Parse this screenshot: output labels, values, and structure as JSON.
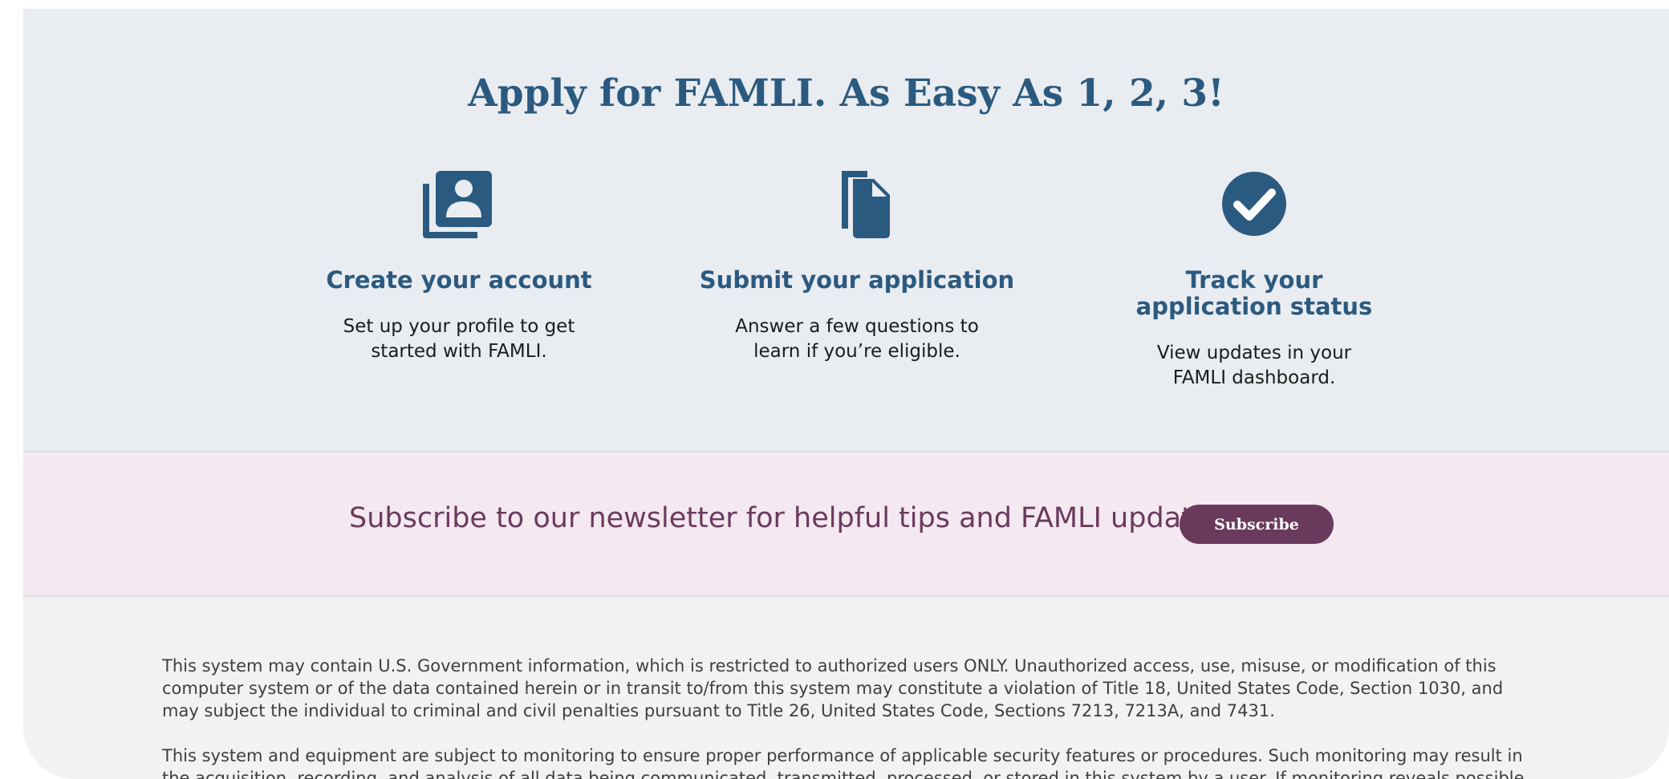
{
  "steps_section": {
    "title": "Apply for FAMLI. As Easy As 1, 2, 3!",
    "steps": [
      {
        "icon": "account-profile-icon",
        "heading": "Create your account",
        "description_line1": "Set up your profile to get",
        "description_line2": "started with FAMLI."
      },
      {
        "icon": "document-icon",
        "heading": "Submit your application",
        "description_line1": "Answer a few questions to",
        "description_line2": "learn if you’re eligible."
      },
      {
        "icon": "checkmark-circle-icon",
        "heading_line1": "Track your",
        "heading_line2": "application status",
        "description_line1": "View updates in your",
        "description_line2": "FAMLI dashboard."
      }
    ]
  },
  "newsletter": {
    "text": "Subscribe to our newsletter for helpful tips and FAMLI updates.",
    "button_label": "Subscribe"
  },
  "disclaimer": {
    "paragraph1": "This system may contain U.S. Government information, which is restricted to authorized users ONLY. Unauthorized access, use, misuse, or modification of this computer system or of the data contained herein or in transit to/from this system may constitute a violation of Title 18, United States Code, Section 1030, and may subject the individual to criminal and civil penalties pursuant to Title 26, United States Code, Sections 7213, 7213A, and 7431.",
    "paragraph2": "This system and equipment are subject to monitoring to ensure proper performance of applicable security features or procedures. Such monitoring may result in the acquisition, recording, and analysis of all data being communicated, transmitted, processed, or stored in this system by a user. If monitoring reveals possible"
  },
  "colors": {
    "steps_background": "#e9ecf0",
    "primary_blue": "#2b5a80",
    "newsletter_background": "#f4e8f1",
    "newsletter_text": "#6b3a5e",
    "subscribe_button": "#6a3a5d",
    "disclaimer_background": "#f2f2f2"
  }
}
